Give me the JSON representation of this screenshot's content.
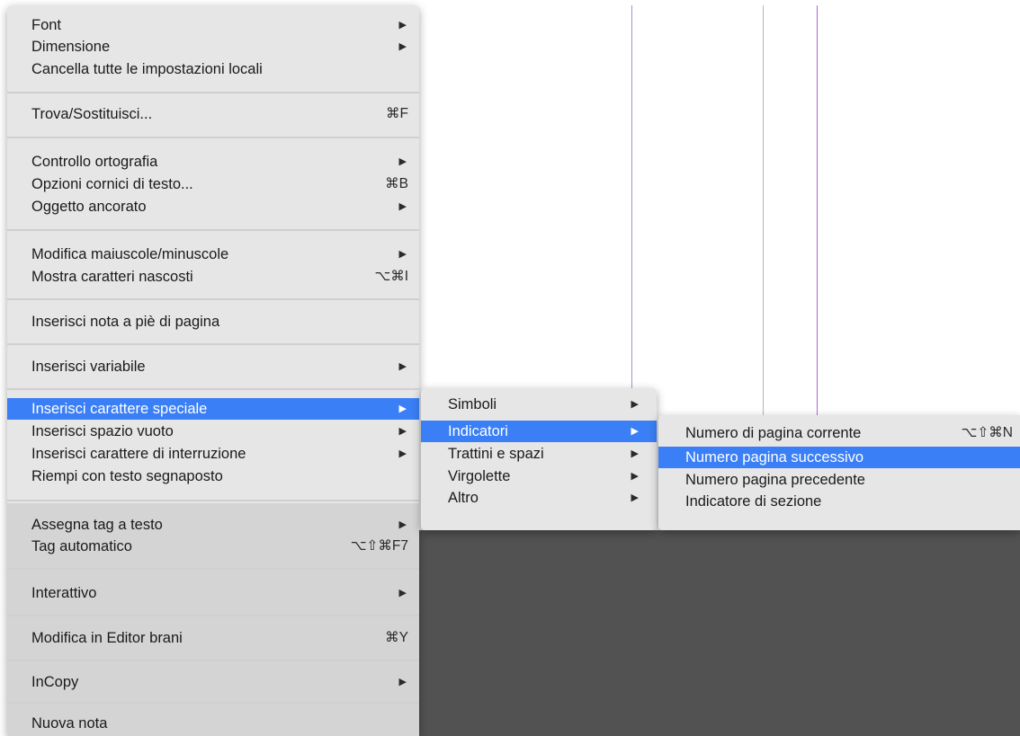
{
  "main_menu": {
    "items": [
      {
        "label": "Font",
        "shortcut": "",
        "submenu": true
      },
      {
        "label": "Dimensione",
        "shortcut": "",
        "submenu": true
      },
      {
        "label": "Cancella tutte le impostazioni locali",
        "shortcut": "",
        "submenu": false
      },
      {
        "label": "Trova/Sostituisci...",
        "shortcut": "⌘F",
        "submenu": false
      },
      {
        "label": "Controllo ortografia",
        "shortcut": "",
        "submenu": true
      },
      {
        "label": "Opzioni cornici di testo...",
        "shortcut": "⌘B",
        "submenu": false
      },
      {
        "label": "Oggetto ancorato",
        "shortcut": "",
        "submenu": true
      },
      {
        "label": "Modifica maiuscole/minuscole",
        "shortcut": "",
        "submenu": true
      },
      {
        "label": "Mostra caratteri nascosti",
        "shortcut": "⌥⌘I",
        "submenu": false
      },
      {
        "label": "Inserisci nota a piè di pagina",
        "shortcut": "",
        "submenu": false
      },
      {
        "label": "Inserisci variabile",
        "shortcut": "",
        "submenu": true
      },
      {
        "label": "Inserisci carattere speciale",
        "shortcut": "",
        "submenu": true,
        "highlighted": true
      },
      {
        "label": "Inserisci spazio vuoto",
        "shortcut": "",
        "submenu": true
      },
      {
        "label": "Inserisci carattere di interruzione",
        "shortcut": "",
        "submenu": true
      },
      {
        "label": "Riempi con testo segnaposto",
        "shortcut": "",
        "submenu": false
      },
      {
        "label": "Assegna tag a testo",
        "shortcut": "",
        "submenu": true
      },
      {
        "label": "Tag automatico",
        "shortcut": "⌥⇧⌘F7",
        "submenu": false
      },
      {
        "label": "Interattivo",
        "shortcut": "",
        "submenu": true
      },
      {
        "label": "Modifica in Editor brani",
        "shortcut": "⌘Y",
        "submenu": false
      },
      {
        "label": "InCopy",
        "shortcut": "",
        "submenu": true
      },
      {
        "label": "Nuova nota",
        "shortcut": "",
        "submenu": false
      }
    ]
  },
  "submenu_special_char": {
    "items": [
      {
        "label": "Simboli",
        "submenu": true
      },
      {
        "label": "Indicatori",
        "submenu": true,
        "highlighted": true
      },
      {
        "label": "Trattini e spazi",
        "submenu": true
      },
      {
        "label": "Virgolette",
        "submenu": true
      },
      {
        "label": "Altro",
        "submenu": true
      }
    ]
  },
  "submenu_markers": {
    "items": [
      {
        "label": "Numero di pagina corrente",
        "shortcut": "⌥⇧⌘N"
      },
      {
        "label": "Numero pagina successivo",
        "shortcut": "",
        "highlighted": true
      },
      {
        "label": "Numero pagina precedente",
        "shortcut": ""
      },
      {
        "label": "Indicatore di sezione",
        "shortcut": ""
      }
    ]
  },
  "icons": {
    "submenu_arrow": "▶"
  },
  "colors": {
    "highlight": "#3a7ff6",
    "menu_background": "#e6e6e6",
    "canvas_dark": "#525252"
  }
}
